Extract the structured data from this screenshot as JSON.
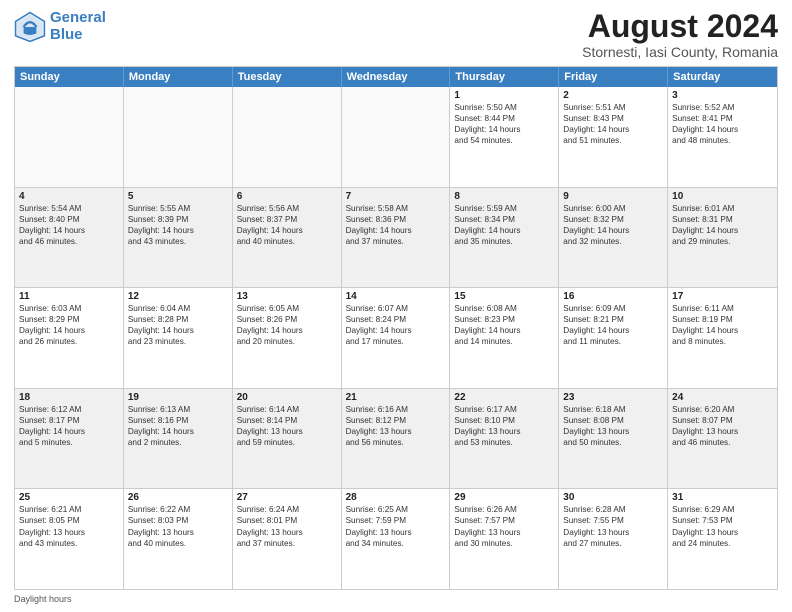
{
  "header": {
    "logo_line1": "General",
    "logo_line2": "Blue",
    "main_title": "August 2024",
    "sub_title": "Stornesti, Iasi County, Romania"
  },
  "days_of_week": [
    "Sunday",
    "Monday",
    "Tuesday",
    "Wednesday",
    "Thursday",
    "Friday",
    "Saturday"
  ],
  "footer": {
    "note": "Daylight hours"
  },
  "weeks": [
    [
      {
        "day": "",
        "info": ""
      },
      {
        "day": "",
        "info": ""
      },
      {
        "day": "",
        "info": ""
      },
      {
        "day": "",
        "info": ""
      },
      {
        "day": "1",
        "info": "Sunrise: 5:50 AM\nSunset: 8:44 PM\nDaylight: 14 hours\nand 54 minutes."
      },
      {
        "day": "2",
        "info": "Sunrise: 5:51 AM\nSunset: 8:43 PM\nDaylight: 14 hours\nand 51 minutes."
      },
      {
        "day": "3",
        "info": "Sunrise: 5:52 AM\nSunset: 8:41 PM\nDaylight: 14 hours\nand 48 minutes."
      }
    ],
    [
      {
        "day": "4",
        "info": "Sunrise: 5:54 AM\nSunset: 8:40 PM\nDaylight: 14 hours\nand 46 minutes."
      },
      {
        "day": "5",
        "info": "Sunrise: 5:55 AM\nSunset: 8:39 PM\nDaylight: 14 hours\nand 43 minutes."
      },
      {
        "day": "6",
        "info": "Sunrise: 5:56 AM\nSunset: 8:37 PM\nDaylight: 14 hours\nand 40 minutes."
      },
      {
        "day": "7",
        "info": "Sunrise: 5:58 AM\nSunset: 8:36 PM\nDaylight: 14 hours\nand 37 minutes."
      },
      {
        "day": "8",
        "info": "Sunrise: 5:59 AM\nSunset: 8:34 PM\nDaylight: 14 hours\nand 35 minutes."
      },
      {
        "day": "9",
        "info": "Sunrise: 6:00 AM\nSunset: 8:32 PM\nDaylight: 14 hours\nand 32 minutes."
      },
      {
        "day": "10",
        "info": "Sunrise: 6:01 AM\nSunset: 8:31 PM\nDaylight: 14 hours\nand 29 minutes."
      }
    ],
    [
      {
        "day": "11",
        "info": "Sunrise: 6:03 AM\nSunset: 8:29 PM\nDaylight: 14 hours\nand 26 minutes."
      },
      {
        "day": "12",
        "info": "Sunrise: 6:04 AM\nSunset: 8:28 PM\nDaylight: 14 hours\nand 23 minutes."
      },
      {
        "day": "13",
        "info": "Sunrise: 6:05 AM\nSunset: 8:26 PM\nDaylight: 14 hours\nand 20 minutes."
      },
      {
        "day": "14",
        "info": "Sunrise: 6:07 AM\nSunset: 8:24 PM\nDaylight: 14 hours\nand 17 minutes."
      },
      {
        "day": "15",
        "info": "Sunrise: 6:08 AM\nSunset: 8:23 PM\nDaylight: 14 hours\nand 14 minutes."
      },
      {
        "day": "16",
        "info": "Sunrise: 6:09 AM\nSunset: 8:21 PM\nDaylight: 14 hours\nand 11 minutes."
      },
      {
        "day": "17",
        "info": "Sunrise: 6:11 AM\nSunset: 8:19 PM\nDaylight: 14 hours\nand 8 minutes."
      }
    ],
    [
      {
        "day": "18",
        "info": "Sunrise: 6:12 AM\nSunset: 8:17 PM\nDaylight: 14 hours\nand 5 minutes."
      },
      {
        "day": "19",
        "info": "Sunrise: 6:13 AM\nSunset: 8:16 PM\nDaylight: 14 hours\nand 2 minutes."
      },
      {
        "day": "20",
        "info": "Sunrise: 6:14 AM\nSunset: 8:14 PM\nDaylight: 13 hours\nand 59 minutes."
      },
      {
        "day": "21",
        "info": "Sunrise: 6:16 AM\nSunset: 8:12 PM\nDaylight: 13 hours\nand 56 minutes."
      },
      {
        "day": "22",
        "info": "Sunrise: 6:17 AM\nSunset: 8:10 PM\nDaylight: 13 hours\nand 53 minutes."
      },
      {
        "day": "23",
        "info": "Sunrise: 6:18 AM\nSunset: 8:08 PM\nDaylight: 13 hours\nand 50 minutes."
      },
      {
        "day": "24",
        "info": "Sunrise: 6:20 AM\nSunset: 8:07 PM\nDaylight: 13 hours\nand 46 minutes."
      }
    ],
    [
      {
        "day": "25",
        "info": "Sunrise: 6:21 AM\nSunset: 8:05 PM\nDaylight: 13 hours\nand 43 minutes."
      },
      {
        "day": "26",
        "info": "Sunrise: 6:22 AM\nSunset: 8:03 PM\nDaylight: 13 hours\nand 40 minutes."
      },
      {
        "day": "27",
        "info": "Sunrise: 6:24 AM\nSunset: 8:01 PM\nDaylight: 13 hours\nand 37 minutes."
      },
      {
        "day": "28",
        "info": "Sunrise: 6:25 AM\nSunset: 7:59 PM\nDaylight: 13 hours\nand 34 minutes."
      },
      {
        "day": "29",
        "info": "Sunrise: 6:26 AM\nSunset: 7:57 PM\nDaylight: 13 hours\nand 30 minutes."
      },
      {
        "day": "30",
        "info": "Sunrise: 6:28 AM\nSunset: 7:55 PM\nDaylight: 13 hours\nand 27 minutes."
      },
      {
        "day": "31",
        "info": "Sunrise: 6:29 AM\nSunset: 7:53 PM\nDaylight: 13 hours\nand 24 minutes."
      }
    ]
  ]
}
